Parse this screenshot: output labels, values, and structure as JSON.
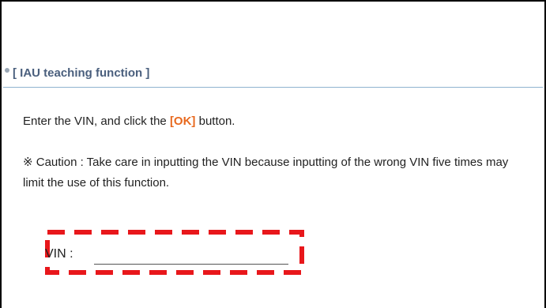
{
  "section": {
    "title": "[ IAU teaching function ]"
  },
  "instruction": {
    "before": "Enter the VIN, and click the ",
    "ok_label": "[OK]",
    "after": " button."
  },
  "caution": {
    "text": "※ Caution : Take care in inputting the VIN because inputting of the wrong VIN five times may limit the use of this function."
  },
  "vin_field": {
    "label": "VIN :",
    "value": "",
    "placeholder": ""
  },
  "colors": {
    "highlight_box": "#e8171b",
    "ok_accent": "#e8691e",
    "section_title": "#4a5f7d"
  }
}
